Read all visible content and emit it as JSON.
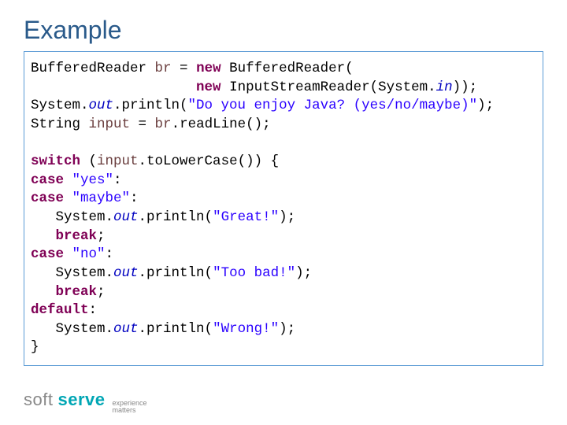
{
  "title": "Example",
  "code": {
    "l1a": "BufferedReader ",
    "l1b": "br",
    "l1c": " = ",
    "l1d": "new",
    "l1e": " BufferedReader(",
    "l2a": "                    ",
    "l2b": "new",
    "l2c": " InputStreamReader(System.",
    "l2d": "in",
    "l2e": "));",
    "l3a": "System.",
    "l3b": "out",
    "l3c": ".println(",
    "l3d": "\"Do you enjoy Java? (yes/no/maybe)\"",
    "l3e": ");",
    "l4a": "String ",
    "l4b": "input",
    "l4c": " = ",
    "l4d": "br",
    "l4e": ".readLine();",
    "l6a": "switch",
    "l6b": " (",
    "l6c": "input",
    "l6d": ".toLowerCase()) {",
    "l7a": "case",
    "l7b": " ",
    "l7c": "\"yes\"",
    "l7d": ":",
    "l8a": "case",
    "l8b": " ",
    "l8c": "\"maybe\"",
    "l8d": ":",
    "l9a": "   System.",
    "l9b": "out",
    "l9c": ".println(",
    "l9d": "\"Great!\"",
    "l9e": ");",
    "l10a": "   ",
    "l10b": "break",
    "l10c": ";",
    "l11a": "case",
    "l11b": " ",
    "l11c": "\"no\"",
    "l11d": ":",
    "l12a": "   System.",
    "l12b": "out",
    "l12c": ".println(",
    "l12d": "\"Too bad!\"",
    "l12e": ");",
    "l13a": "   ",
    "l13b": "break",
    "l13c": ";",
    "l14a": "default",
    "l14b": ":",
    "l15a": "   System.",
    "l15b": "out",
    "l15c": ".println(",
    "l15d": "\"Wrong!\"",
    "l15e": ");",
    "l16a": "}"
  },
  "footer": {
    "soft": "soft",
    "serve": "serve",
    "tag1": "experience",
    "tag2": "matters"
  }
}
